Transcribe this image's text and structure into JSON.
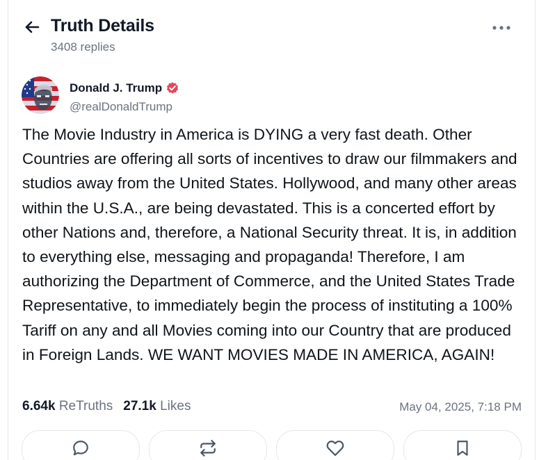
{
  "header": {
    "title": "Truth Details",
    "replies": "3408 replies"
  },
  "author": {
    "name": "Donald J. Trump",
    "handle": "@realDonaldTrump"
  },
  "post": {
    "text": "The Movie Industry in America is DYING a very fast death. Other Countries are offering all sorts of incentives to draw our filmmakers and studios away from the United States. Hollywood, and many other areas within the U.S.A., are being devastated. This is a concerted effort by other Nations and, therefore, a National Security threat. It is, in addition to everything else, messaging and propaganda! Therefore, I am authorizing the Department of Commerce, and the United States Trade Representative, to immediately begin the process of instituting a 100% Tariff on any and all Movies coming into our Country that are produced in Foreign Lands. WE WANT MOVIES MADE IN AMERICA, AGAIN!",
    "retruths_count": "6.64k",
    "retruths_label": "ReTruths",
    "likes_count": "27.1k",
    "likes_label": "Likes",
    "timestamp": "May 04, 2025, 7:18 PM"
  },
  "icons": {
    "back": "arrow-left-icon",
    "more": "more-horizontal-icon",
    "verified": "verified-badge-icon",
    "reply": "chat-bubble-icon",
    "retruth": "repost-icon",
    "like": "heart-icon",
    "bookmark": "bookmark-icon"
  },
  "colors": {
    "verified_badge": "#e6475b",
    "text_primary": "#111827",
    "text_secondary": "#6b7280",
    "border": "#e5e7eb"
  }
}
